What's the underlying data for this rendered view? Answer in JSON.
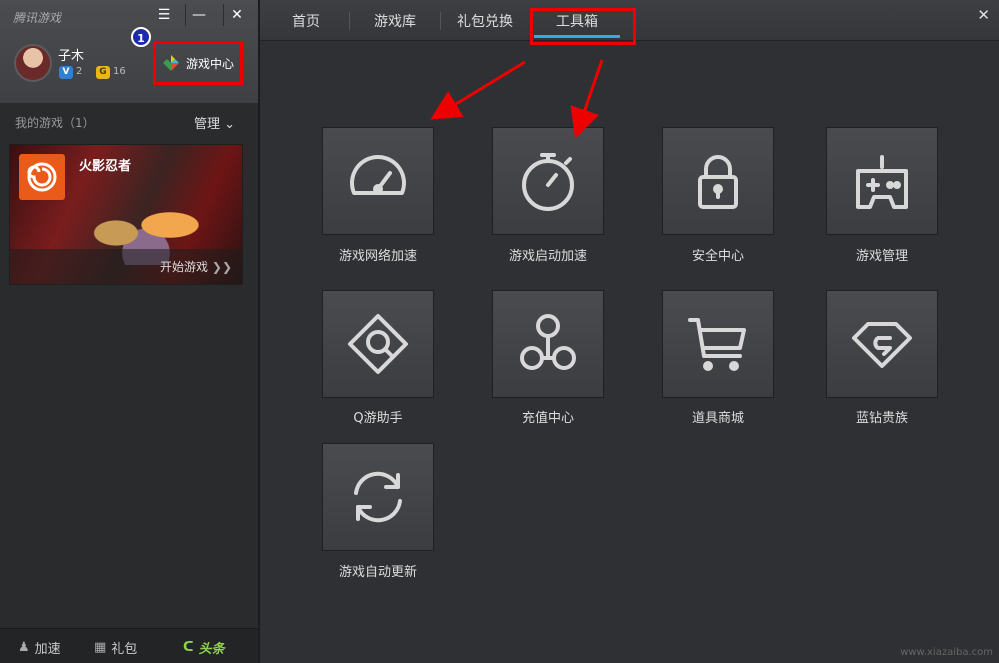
{
  "app_title": "腾讯游戏",
  "window_controls": {
    "menu": "☰",
    "minimize": "—",
    "close": "✕"
  },
  "user": {
    "name": "子木",
    "vip_level": "2",
    "gold_level": "16"
  },
  "annotation_number": "1",
  "game_center_label": "游戏中心",
  "my_games": {
    "label": "我的游戏（1）",
    "manage_label": "管理"
  },
  "game": {
    "name": "火影忍者",
    "start_label": "开始游戏"
  },
  "bottom_bar": {
    "speed": "加速",
    "gift": "礼包",
    "headline": "头条"
  },
  "tabs": [
    {
      "label": "首页"
    },
    {
      "label": "游戏库"
    },
    {
      "label": "礼包兑换"
    },
    {
      "label": "工具箱",
      "active": true
    }
  ],
  "right_close": "✕",
  "tools": [
    {
      "label": "游戏网络加速",
      "icon": "speedometer-icon"
    },
    {
      "label": "游戏启动加速",
      "icon": "stopwatch-icon"
    },
    {
      "label": "安全中心",
      "icon": "lock-icon"
    },
    {
      "label": "游戏管理",
      "icon": "gamepad-icon"
    },
    {
      "label": "Q游助手",
      "icon": "magnifier-diamond-icon"
    },
    {
      "label": "充值中心",
      "icon": "network-nodes-icon"
    },
    {
      "label": "道具商城",
      "icon": "shopping-cart-icon"
    },
    {
      "label": "蓝钻贵族",
      "icon": "diamond-icon"
    },
    {
      "label": "游戏自动更新",
      "icon": "refresh-icon"
    }
  ],
  "watermark": "www.xiazaiba.com",
  "colors": {
    "annotation_red": "#ee0000",
    "tab_active": "#3aa8e0",
    "headline_green": "#8fd14a"
  }
}
